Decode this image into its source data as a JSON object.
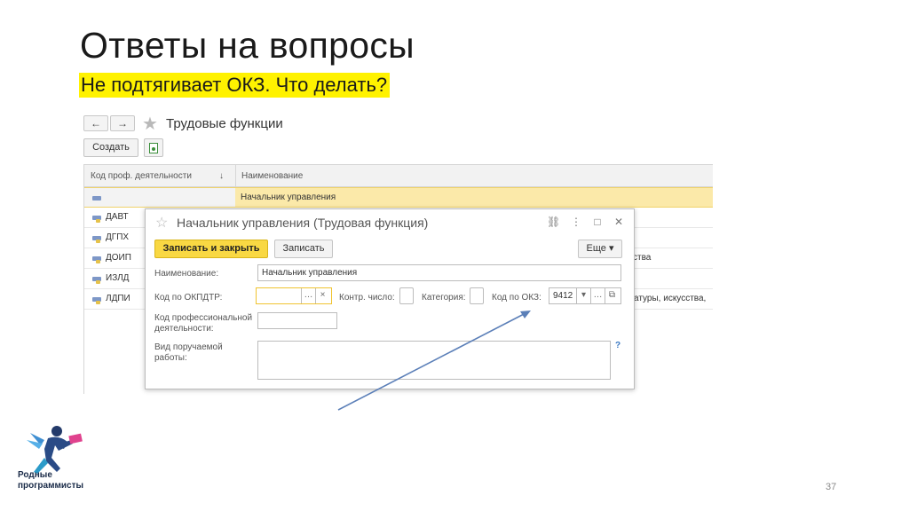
{
  "slide": {
    "title": "Ответы на вопросы",
    "subtitle": "Не подтягивает ОКЗ. Что делать?",
    "page_number": "37",
    "logo_text": "Родные\nпрограммисты"
  },
  "list_window": {
    "back_icon": "arrow-left-icon",
    "forward_icon": "arrow-right-icon",
    "title": "Трудовые функции",
    "create_button": "Создать",
    "columns": [
      "Код проф. деятельности",
      "Наименование"
    ],
    "sort_indicator": "↓",
    "rows": [
      {
        "code": "",
        "name": "Начальник управления",
        "selected": true
      },
      {
        "code": "ДАВТ",
        "name": ""
      },
      {
        "code": "ДГПХ",
        "name": ""
      },
      {
        "code": "ДОИП",
        "name": "ства"
      },
      {
        "code": "ИЗЛД",
        "name": ""
      },
      {
        "code": "ЛДПИ",
        "name": "атуры, искусства,"
      }
    ]
  },
  "dialog": {
    "title": "Начальник управления (Трудовая функция)",
    "save_close_button": "Записать и закрыть",
    "save_button": "Записать",
    "more_button": "Еще",
    "fields": {
      "name_label": "Наименование:",
      "name_value": "Начальник управления",
      "okpdtr_label": "Код по ОКПДТР:",
      "okpdtr_value": "",
      "control_label": "Контр. число:",
      "category_label": "Категория:",
      "okz_label": "Код по ОКЗ:",
      "okz_value": "9412",
      "prof_label": "Код профессиональной деятельности:",
      "prof_value": "",
      "work_label": "Вид поручаемой работы:",
      "help_mark": "?"
    },
    "icons": {
      "link": "link-icon",
      "menu": "more-vertical-icon",
      "maximize": "maximize-icon",
      "close": "close-icon"
    }
  },
  "colors": {
    "highlight": "#fff200",
    "accent_button": "#f9d843",
    "selected_row": "#fbe9a9",
    "arrow": "#5b7fb8"
  }
}
